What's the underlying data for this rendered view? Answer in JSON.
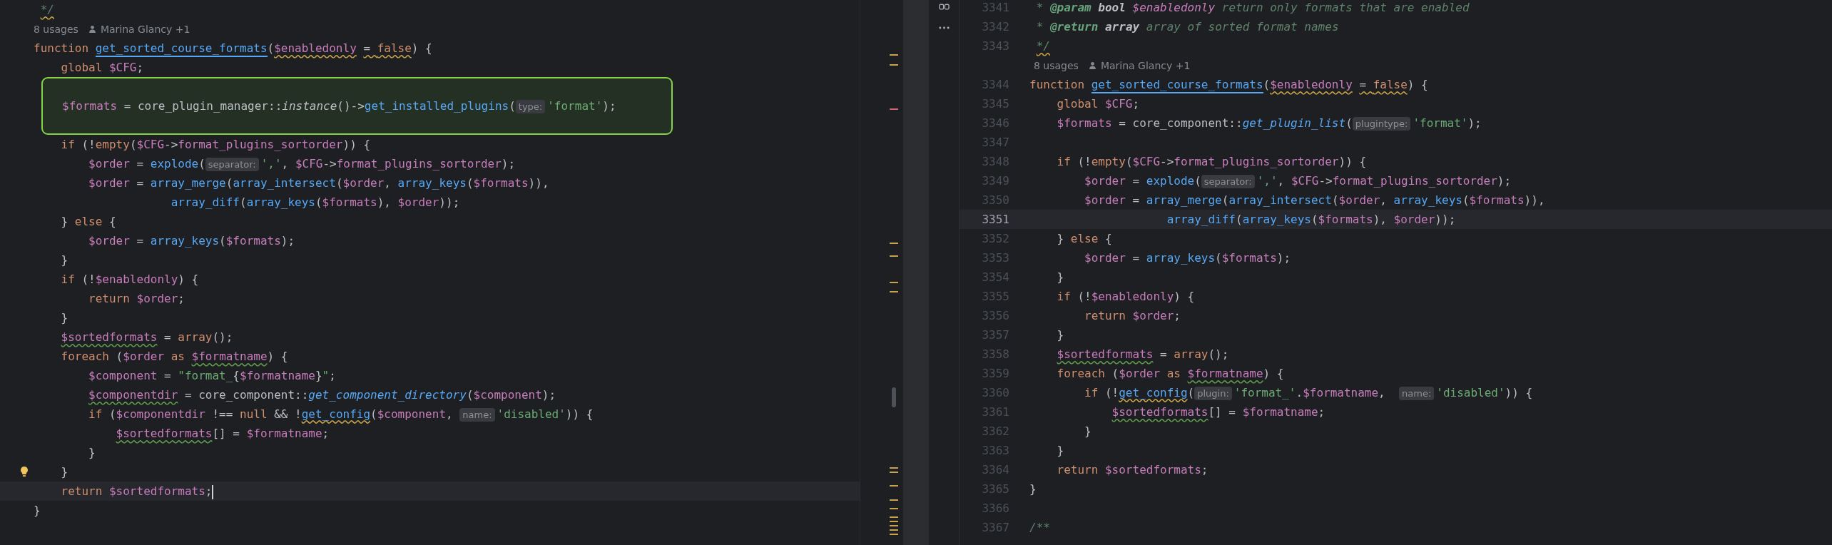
{
  "left_pane": {
    "lines": [
      {
        "kind": "code",
        "tokens": [
          {
            "kind": "doc",
            "text": " */",
            "inspection_warning": true
          }
        ]
      },
      {
        "kind": "usages",
        "usages": "8 usages",
        "author": "Marina Glancy +1"
      },
      {
        "kind": "code",
        "tokens": [
          {
            "kind": "keyword",
            "text": "function "
          },
          {
            "kind": "func",
            "text": "get_sorted_course_formats",
            "underlined": true
          },
          {
            "kind": "plain",
            "text": "("
          },
          {
            "kind": "var",
            "text": "$enabledonly",
            "inspection_warning": true
          },
          {
            "kind": "plain",
            "text": " = ",
            "inspection_warning": true
          },
          {
            "kind": "keyword",
            "text": "false",
            "inspection_warning": true
          },
          {
            "kind": "plain",
            "text": ") {"
          }
        ]
      },
      {
        "kind": "code",
        "tokens": [
          {
            "kind": "keyword",
            "text": "    global "
          },
          {
            "kind": "var",
            "text": "$CFG"
          },
          {
            "kind": "plain",
            "text": ";"
          }
        ]
      },
      {
        "kind": "change",
        "tokens": [
          {
            "kind": "var",
            "text": "$formats"
          },
          {
            "kind": "plain",
            "text": " = core_plugin_manager::"
          },
          {
            "kind": "italic",
            "text": "instance"
          },
          {
            "kind": "plain",
            "text": "()->"
          },
          {
            "kind": "func",
            "text": "get_installed_plugins"
          },
          {
            "kind": "plain",
            "text": "("
          },
          {
            "kind": "hint",
            "text": "type:"
          },
          {
            "kind": "string",
            "text": "'format'"
          },
          {
            "kind": "plain",
            "text": ");"
          }
        ]
      },
      {
        "kind": "code",
        "tokens": [
          {
            "kind": "keyword",
            "text": "    if"
          },
          {
            "kind": "plain",
            "text": " (!"
          },
          {
            "kind": "keyword",
            "text": "empty"
          },
          {
            "kind": "plain",
            "text": "("
          },
          {
            "kind": "var",
            "text": "$CFG"
          },
          {
            "kind": "plain",
            "text": "->"
          },
          {
            "kind": "var",
            "text": "format_plugins_sortorder"
          },
          {
            "kind": "plain",
            "text": ")) {"
          }
        ]
      },
      {
        "kind": "code",
        "tokens": [
          {
            "kind": "var",
            "text": "        $order"
          },
          {
            "kind": "plain",
            "text": " = "
          },
          {
            "kind": "func",
            "text": "explode"
          },
          {
            "kind": "plain",
            "text": "("
          },
          {
            "kind": "hint",
            "text": "separator:"
          },
          {
            "kind": "string",
            "text": "','"
          },
          {
            "kind": "plain",
            "text": ", "
          },
          {
            "kind": "var",
            "text": "$CFG"
          },
          {
            "kind": "plain",
            "text": "->"
          },
          {
            "kind": "var",
            "text": "format_plugins_sortorder"
          },
          {
            "kind": "plain",
            "text": ");"
          }
        ]
      },
      {
        "kind": "code",
        "tokens": [
          {
            "kind": "var",
            "text": "        $order"
          },
          {
            "kind": "plain",
            "text": " = "
          },
          {
            "kind": "func",
            "text": "array_merge"
          },
          {
            "kind": "plain",
            "text": "("
          },
          {
            "kind": "func",
            "text": "array_intersect"
          },
          {
            "kind": "plain",
            "text": "("
          },
          {
            "kind": "var",
            "text": "$order"
          },
          {
            "kind": "plain",
            "text": ", "
          },
          {
            "kind": "func",
            "text": "array_keys"
          },
          {
            "kind": "plain",
            "text": "("
          },
          {
            "kind": "var",
            "text": "$formats"
          },
          {
            "kind": "plain",
            "text": ")),"
          }
        ]
      },
      {
        "kind": "code",
        "tokens": [
          {
            "kind": "func",
            "text": "                    array_diff"
          },
          {
            "kind": "plain",
            "text": "("
          },
          {
            "kind": "func",
            "text": "array_keys"
          },
          {
            "kind": "plain",
            "text": "("
          },
          {
            "kind": "var",
            "text": "$formats"
          },
          {
            "kind": "plain",
            "text": "), "
          },
          {
            "kind": "var",
            "text": "$order"
          },
          {
            "kind": "plain",
            "text": "));"
          }
        ]
      },
      {
        "kind": "code",
        "tokens": [
          {
            "kind": "plain",
            "text": "    } "
          },
          {
            "kind": "keyword",
            "text": "else"
          },
          {
            "kind": "plain",
            "text": " {"
          }
        ]
      },
      {
        "kind": "code",
        "tokens": [
          {
            "kind": "var",
            "text": "        $order"
          },
          {
            "kind": "plain",
            "text": " = "
          },
          {
            "kind": "func",
            "text": "array_keys"
          },
          {
            "kind": "plain",
            "text": "("
          },
          {
            "kind": "var",
            "text": "$formats"
          },
          {
            "kind": "plain",
            "text": ");"
          }
        ]
      },
      {
        "kind": "code",
        "tokens": [
          {
            "kind": "plain",
            "text": "    }"
          }
        ]
      },
      {
        "kind": "code",
        "tokens": [
          {
            "kind": "keyword",
            "text": "    if"
          },
          {
            "kind": "plain",
            "text": " (!"
          },
          {
            "kind": "var",
            "text": "$enabledonly"
          },
          {
            "kind": "plain",
            "text": ") {"
          }
        ]
      },
      {
        "kind": "code",
        "tokens": [
          {
            "kind": "keyword",
            "text": "        return "
          },
          {
            "kind": "var",
            "text": "$order"
          },
          {
            "kind": "plain",
            "text": ";"
          }
        ]
      },
      {
        "kind": "code",
        "tokens": [
          {
            "kind": "plain",
            "text": "    }"
          }
        ]
      },
      {
        "kind": "code",
        "tokens": [
          {
            "kind": "var",
            "text": "    $sortedformats",
            "spelling_warning": true
          },
          {
            "kind": "plain",
            "text": " = "
          },
          {
            "kind": "keyword",
            "text": "array"
          },
          {
            "kind": "plain",
            "text": "();"
          }
        ]
      },
      {
        "kind": "code",
        "tokens": [
          {
            "kind": "keyword",
            "text": "    foreach"
          },
          {
            "kind": "plain",
            "text": " ("
          },
          {
            "kind": "var",
            "text": "$order"
          },
          {
            "kind": "keyword",
            "text": " as "
          },
          {
            "kind": "var",
            "text": "$formatname",
            "spelling_warning": true
          },
          {
            "kind": "plain",
            "text": ") {"
          }
        ]
      },
      {
        "kind": "code",
        "tokens": [
          {
            "kind": "var",
            "text": "        $component"
          },
          {
            "kind": "plain",
            "text": " = "
          },
          {
            "kind": "string",
            "text": "\"format_"
          },
          {
            "kind": "plain",
            "text": "{"
          },
          {
            "kind": "var",
            "text": "$formatname"
          },
          {
            "kind": "plain",
            "text": "}"
          },
          {
            "kind": "string",
            "text": "\""
          },
          {
            "kind": "plain",
            "text": ";"
          }
        ]
      },
      {
        "kind": "code",
        "tokens": [
          {
            "kind": "var",
            "text": "        $componentdir",
            "spelling_warning": true
          },
          {
            "kind": "plain",
            "text": " = core_component::"
          },
          {
            "kind": "func-italic",
            "text": "get_component_directory"
          },
          {
            "kind": "plain",
            "text": "("
          },
          {
            "kind": "var",
            "text": "$component"
          },
          {
            "kind": "plain",
            "text": ");"
          }
        ]
      },
      {
        "kind": "code",
        "tokens": [
          {
            "kind": "keyword",
            "text": "        if"
          },
          {
            "kind": "plain",
            "text": " ("
          },
          {
            "kind": "var",
            "text": "$componentdir"
          },
          {
            "kind": "plain",
            "text": " !== "
          },
          {
            "kind": "keyword",
            "text": "null"
          },
          {
            "kind": "plain",
            "text": " && !"
          },
          {
            "kind": "func",
            "text": "get_config",
            "inspection_warning": true
          },
          {
            "kind": "plain",
            "text": "("
          },
          {
            "kind": "var",
            "text": "$component"
          },
          {
            "kind": "plain",
            "text": ", "
          },
          {
            "kind": "hint",
            "text": "name:"
          },
          {
            "kind": "string",
            "text": "'disabled'"
          },
          {
            "kind": "plain",
            "text": ")) {"
          }
        ]
      },
      {
        "kind": "code",
        "tokens": [
          {
            "kind": "var",
            "text": "            $sortedformats",
            "spelling_warning": true
          },
          {
            "kind": "plain",
            "text": "[] = "
          },
          {
            "kind": "var",
            "text": "$formatname"
          },
          {
            "kind": "plain",
            "text": ";"
          }
        ]
      },
      {
        "kind": "code",
        "tokens": [
          {
            "kind": "plain",
            "text": "        }"
          }
        ]
      },
      {
        "kind": "code",
        "lightbulb": true,
        "tokens": [
          {
            "kind": "plain",
            "text": "    }"
          }
        ]
      },
      {
        "kind": "code",
        "current": true,
        "caret": true,
        "tokens": [
          {
            "kind": "keyword",
            "text": "    return "
          },
          {
            "kind": "var",
            "text": "$sortedformats"
          },
          {
            "kind": "plain",
            "text": ";"
          }
        ]
      },
      {
        "kind": "code",
        "tokens": [
          {
            "kind": "plain",
            "text": "}"
          }
        ]
      }
    ]
  },
  "right_pane": {
    "lines": [
      {
        "kind": "code",
        "number": "3341",
        "tokens": [
          {
            "kind": "doc",
            "text": " * "
          },
          {
            "kind": "doc-tag",
            "text": "@param"
          },
          {
            "kind": "doc-type",
            "text": " bool "
          },
          {
            "kind": "doc-var",
            "text": "$enabledonly"
          },
          {
            "kind": "doc",
            "text": " return only formats that are enabled"
          }
        ]
      },
      {
        "kind": "code",
        "number": "3342",
        "tokens": [
          {
            "kind": "doc",
            "text": " * "
          },
          {
            "kind": "doc-tag",
            "text": "@return"
          },
          {
            "kind": "doc-type",
            "text": " array"
          },
          {
            "kind": "doc",
            "text": " array of sorted format names"
          }
        ]
      },
      {
        "kind": "code",
        "number": "3343",
        "tokens": [
          {
            "kind": "doc",
            "text": " */",
            "inspection_warning": true
          }
        ]
      },
      {
        "kind": "usages",
        "usages": "8 usages",
        "author": "Marina Glancy +1"
      },
      {
        "kind": "code",
        "number": "3344",
        "tokens": [
          {
            "kind": "keyword",
            "text": "function "
          },
          {
            "kind": "func",
            "text": "get_sorted_course_formats",
            "underlined": true
          },
          {
            "kind": "plain",
            "text": "("
          },
          {
            "kind": "var",
            "text": "$enabledonly",
            "inspection_warning": true
          },
          {
            "kind": "plain",
            "text": " = ",
            "inspection_warning": true
          },
          {
            "kind": "keyword",
            "text": "false",
            "inspection_warning": true
          },
          {
            "kind": "plain",
            "text": ") {"
          }
        ]
      },
      {
        "kind": "code",
        "number": "3345",
        "tokens": [
          {
            "kind": "keyword",
            "text": "    global "
          },
          {
            "kind": "var",
            "text": "$CFG"
          },
          {
            "kind": "plain",
            "text": ";"
          }
        ]
      },
      {
        "kind": "code",
        "number": "3346",
        "tokens": [
          {
            "kind": "var",
            "text": "    $formats"
          },
          {
            "kind": "plain",
            "text": " = core_component::"
          },
          {
            "kind": "func-italic",
            "text": "get_plugin_list"
          },
          {
            "kind": "plain",
            "text": "("
          },
          {
            "kind": "hint",
            "text": "plugintype:"
          },
          {
            "kind": "string",
            "text": "'format'"
          },
          {
            "kind": "plain",
            "text": ");"
          }
        ]
      },
      {
        "kind": "code",
        "number": "3347"
      },
      {
        "kind": "code",
        "number": "3348",
        "tokens": [
          {
            "kind": "keyword",
            "text": "    if"
          },
          {
            "kind": "plain",
            "text": " (!"
          },
          {
            "kind": "keyword",
            "text": "empty"
          },
          {
            "kind": "plain",
            "text": "("
          },
          {
            "kind": "var",
            "text": "$CFG"
          },
          {
            "kind": "plain",
            "text": "->"
          },
          {
            "kind": "var",
            "text": "format_plugins_sortorder"
          },
          {
            "kind": "plain",
            "text": ")) {"
          }
        ]
      },
      {
        "kind": "code",
        "number": "3349",
        "tokens": [
          {
            "kind": "var",
            "text": "        $order"
          },
          {
            "kind": "plain",
            "text": " = "
          },
          {
            "kind": "func",
            "text": "explode"
          },
          {
            "kind": "plain",
            "text": "("
          },
          {
            "kind": "hint",
            "text": "separator:"
          },
          {
            "kind": "string",
            "text": "','"
          },
          {
            "kind": "plain",
            "text": ", "
          },
          {
            "kind": "var",
            "text": "$CFG"
          },
          {
            "kind": "plain",
            "text": "->"
          },
          {
            "kind": "var",
            "text": "format_plugins_sortorder"
          },
          {
            "kind": "plain",
            "text": ");"
          }
        ]
      },
      {
        "kind": "code",
        "number": "3350",
        "tokens": [
          {
            "kind": "var",
            "text": "        $order"
          },
          {
            "kind": "plain",
            "text": " = "
          },
          {
            "kind": "func",
            "text": "array_merge"
          },
          {
            "kind": "plain",
            "text": "("
          },
          {
            "kind": "func",
            "text": "array_intersect"
          },
          {
            "kind": "plain",
            "text": "("
          },
          {
            "kind": "var",
            "text": "$order"
          },
          {
            "kind": "plain",
            "text": ", "
          },
          {
            "kind": "func",
            "text": "array_keys"
          },
          {
            "kind": "plain",
            "text": "("
          },
          {
            "kind": "var",
            "text": "$formats"
          },
          {
            "kind": "plain",
            "text": ")),"
          }
        ]
      },
      {
        "kind": "code",
        "number": "3351",
        "current": true,
        "tokens": [
          {
            "kind": "func",
            "text": "                    array_diff"
          },
          {
            "kind": "plain",
            "text": "("
          },
          {
            "kind": "func",
            "text": "array_keys"
          },
          {
            "kind": "plain",
            "text": "("
          },
          {
            "kind": "var",
            "text": "$formats"
          },
          {
            "kind": "plain",
            "text": "), "
          },
          {
            "kind": "var",
            "text": "$order"
          },
          {
            "kind": "plain",
            "text": "));"
          }
        ]
      },
      {
        "kind": "code",
        "number": "3352",
        "tokens": [
          {
            "kind": "plain",
            "text": "    } "
          },
          {
            "kind": "keyword",
            "text": "else"
          },
          {
            "kind": "plain",
            "text": " {"
          }
        ]
      },
      {
        "kind": "code",
        "number": "3353",
        "tokens": [
          {
            "kind": "var",
            "text": "        $order"
          },
          {
            "kind": "plain",
            "text": " = "
          },
          {
            "kind": "func",
            "text": "array_keys"
          },
          {
            "kind": "plain",
            "text": "("
          },
          {
            "kind": "var",
            "text": "$formats"
          },
          {
            "kind": "plain",
            "text": ");"
          }
        ]
      },
      {
        "kind": "code",
        "number": "3354",
        "tokens": [
          {
            "kind": "plain",
            "text": "    }"
          }
        ]
      },
      {
        "kind": "code",
        "number": "3355",
        "tokens": [
          {
            "kind": "keyword",
            "text": "    if"
          },
          {
            "kind": "plain",
            "text": " (!"
          },
          {
            "kind": "var",
            "text": "$enabledonly"
          },
          {
            "kind": "plain",
            "text": ") {"
          }
        ]
      },
      {
        "kind": "code",
        "number": "3356",
        "tokens": [
          {
            "kind": "keyword",
            "text": "        return "
          },
          {
            "kind": "var",
            "text": "$order"
          },
          {
            "kind": "plain",
            "text": ";"
          }
        ]
      },
      {
        "kind": "code",
        "number": "3357",
        "tokens": [
          {
            "kind": "plain",
            "text": "    }"
          }
        ]
      },
      {
        "kind": "code",
        "number": "3358",
        "tokens": [
          {
            "kind": "var",
            "text": "    $sortedformats",
            "spelling_warning": true
          },
          {
            "kind": "plain",
            "text": " = "
          },
          {
            "kind": "keyword",
            "text": "array"
          },
          {
            "kind": "plain",
            "text": "();"
          }
        ]
      },
      {
        "kind": "code",
        "number": "3359",
        "tokens": [
          {
            "kind": "keyword",
            "text": "    foreach"
          },
          {
            "kind": "plain",
            "text": " ("
          },
          {
            "kind": "var",
            "text": "$order"
          },
          {
            "kind": "keyword",
            "text": " as "
          },
          {
            "kind": "var",
            "text": "$formatname",
            "spelling_warning": true
          },
          {
            "kind": "plain",
            "text": ") {"
          }
        ]
      },
      {
        "kind": "code",
        "number": "3360",
        "tokens": [
          {
            "kind": "keyword",
            "text": "        if"
          },
          {
            "kind": "plain",
            "text": " (!"
          },
          {
            "kind": "func",
            "text": "get_config",
            "inspection_warning": true
          },
          {
            "kind": "plain",
            "text": "("
          },
          {
            "kind": "hint",
            "text": "plugin:"
          },
          {
            "kind": "string",
            "text": "'format_'"
          },
          {
            "kind": "plain",
            "text": "."
          },
          {
            "kind": "var",
            "text": "$formatname"
          },
          {
            "kind": "plain",
            "text": ",  "
          },
          {
            "kind": "hint",
            "text": "name:"
          },
          {
            "kind": "string",
            "text": "'disabled'"
          },
          {
            "kind": "plain",
            "text": ")) {"
          }
        ]
      },
      {
        "kind": "code",
        "number": "3361",
        "tokens": [
          {
            "kind": "var",
            "text": "            $sortedformats",
            "spelling_warning": true
          },
          {
            "kind": "plain",
            "text": "[] = "
          },
          {
            "kind": "var",
            "text": "$formatname"
          },
          {
            "kind": "plain",
            "text": ";"
          }
        ]
      },
      {
        "kind": "code",
        "number": "3362",
        "tokens": [
          {
            "kind": "plain",
            "text": "        }"
          }
        ]
      },
      {
        "kind": "code",
        "number": "3363",
        "tokens": [
          {
            "kind": "plain",
            "text": "    }"
          }
        ]
      },
      {
        "kind": "code",
        "number": "3364",
        "tokens": [
          {
            "kind": "keyword",
            "text": "    return "
          },
          {
            "kind": "var",
            "text": "$sortedformats"
          },
          {
            "kind": "plain",
            "text": ";"
          }
        ]
      },
      {
        "kind": "code",
        "number": "3365",
        "tokens": [
          {
            "kind": "plain",
            "text": "}"
          }
        ]
      },
      {
        "kind": "code",
        "number": "3366"
      },
      {
        "kind": "code",
        "number": "3367",
        "tokens": [
          {
            "kind": "doc",
            "text": "/**"
          }
        ]
      }
    ]
  }
}
